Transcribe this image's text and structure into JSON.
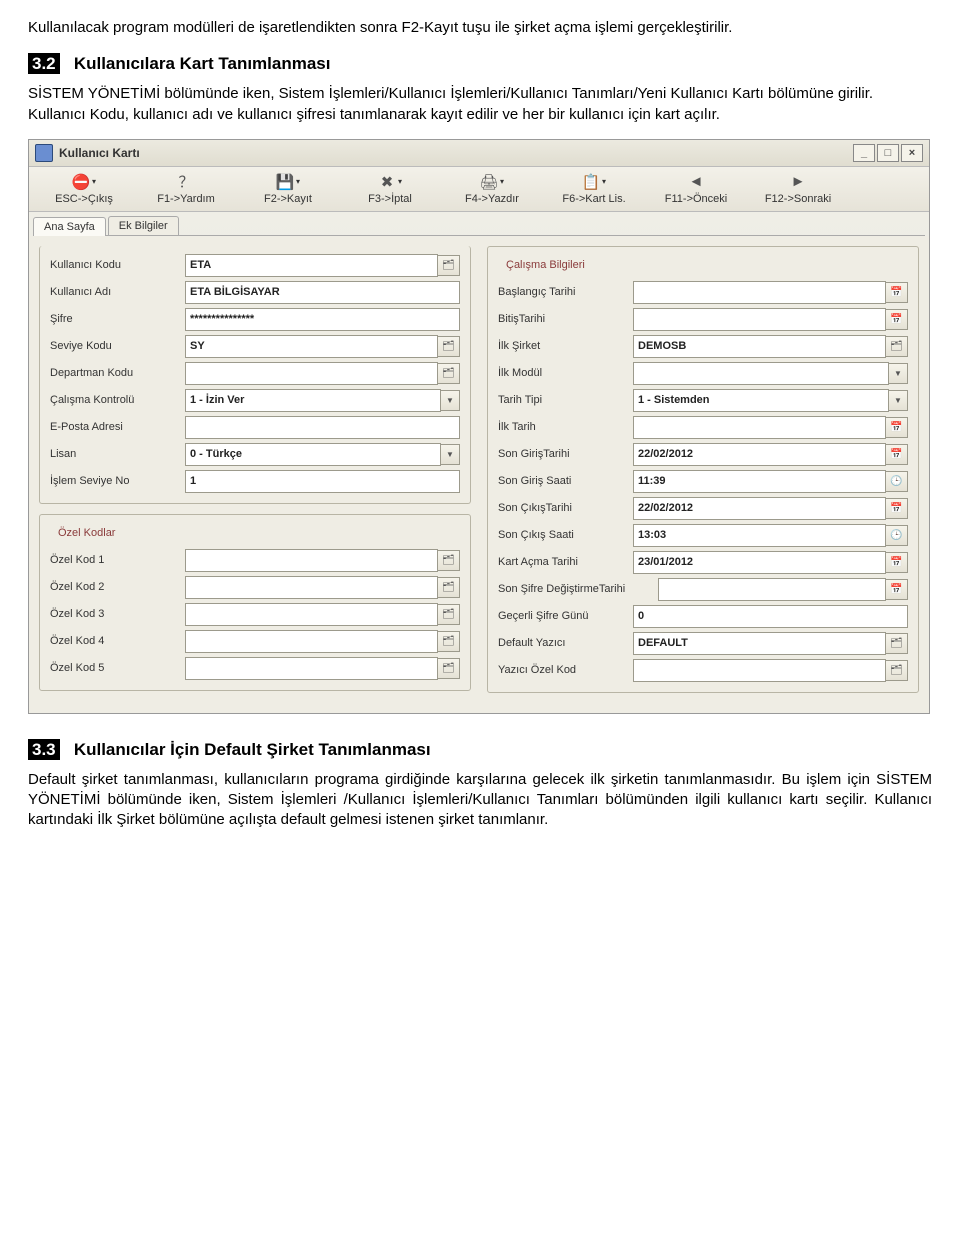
{
  "doc": {
    "intro": "Kullanılacak program modülleri de işaretlendikten sonra F2-Kayıt tuşu ile şirket açma işlemi gerçekleştirilir.",
    "s32_num": "3.2",
    "s32_title": "Kullanıcılara Kart Tanımlanması",
    "s32_body": "SİSTEM YÖNETİMİ bölümünde iken, Sistem İşlemleri/Kullanıcı İşlemleri/Kullanıcı Tanımları/Yeni Kullanıcı Kartı bölümüne girilir.\nKullanıcı Kodu, kullanıcı adı ve kullanıcı şifresi tanımlanarak kayıt edilir ve her bir kullanıcı için kart açılır.",
    "s33_num": "3.3",
    "s33_title": "Kullanıcılar İçin Default Şirket Tanımlanması",
    "s33_body": "Default şirket tanımlanması, kullanıcıların programa girdiğinde karşılarına gelecek ilk şirketin tanımlanmasıdır. Bu işlem için SİSTEM YÖNETİMİ bölümünde iken, Sistem İşlemleri /Kullanıcı İşlemleri/Kullanıcı Tanımları bölümünden ilgili kullanıcı kartı seçilir. Kullanıcı kartındaki İlk Şirket bölümüne açılışta default gelmesi istenen şirket tanımlanır."
  },
  "window": {
    "title": "Kullanıcı Kartı",
    "toolbar": {
      "esc": "ESC->Çıkış",
      "f1": "F1->Yardım",
      "f2": "F2->Kayıt",
      "f3": "F3->İptal",
      "f4": "F4->Yazdır",
      "f6": "F6->Kart Lis.",
      "f11": "F11->Önceki",
      "f12": "F12->Sonraki"
    },
    "tabs": {
      "t1": "Ana Sayfa",
      "t2": "Ek Bilgiler"
    },
    "left": {
      "kod_l": "Kullanıcı Kodu",
      "kod_v": "ETA",
      "adi_l": "Kullanıcı Adı",
      "adi_v": "ETA BİLGİSAYAR",
      "sifre_l": "Şifre",
      "sifre_v": "***************",
      "seviye_l": "Seviye Kodu",
      "seviye_v": "SY",
      "dept_l": "Departman Kodu",
      "dept_v": "",
      "calisma_l": "Çalışma Kontrolü",
      "calisma_v": "1 - İzin Ver",
      "eposta_l": "E-Posta Adresi",
      "eposta_v": "",
      "lisan_l": "Lisan",
      "lisan_v": "0 - Türkçe",
      "isno_l": "İşlem Seviye No",
      "isno_v": "1",
      "ozel_legend": "Özel Kodlar",
      "ok1_l": "Özel Kod 1",
      "ok2_l": "Özel Kod 2",
      "ok3_l": "Özel Kod 3",
      "ok4_l": "Özel Kod 4",
      "ok5_l": "Özel Kod 5"
    },
    "right": {
      "legend": "Çalışma Bilgileri",
      "bas_l": "Başlangıç Tarihi",
      "bas_v": "",
      "bit_l": "BitişTarihi",
      "bit_v": "",
      "ilks_l": "İlk Şirket",
      "ilks_v": "DEMOSB",
      "ilkm_l": "İlk Modül",
      "ilkm_v": "",
      "ttip_l": "Tarih Tipi",
      "ttip_v": "1 - Sistemden",
      "ilkt_l": "İlk Tarih",
      "ilkt_v": "",
      "sgt_l": "Son GirişTarihi",
      "sgt_v": "22/02/2012",
      "sgs_l": "Son Giriş Saati",
      "sgs_v": "11:39",
      "sct_l": "Son ÇıkışTarihi",
      "sct_v": "22/02/2012",
      "scs_l": "Son Çıkış Saati",
      "scs_v": "13:03",
      "kat_l": "Kart Açma Tarihi",
      "kat_v": "23/01/2012",
      "ssdt_l": "Son Şifre DeğiştirmeTarihi",
      "ssdt_v": "",
      "gsg_l": "Geçerli Şifre Günü",
      "gsg_v": "0",
      "dy_l": "Default Yazıcı",
      "dy_v": "DEFAULT",
      "yok_l": "Yazıcı Özel Kod",
      "yok_v": ""
    }
  }
}
